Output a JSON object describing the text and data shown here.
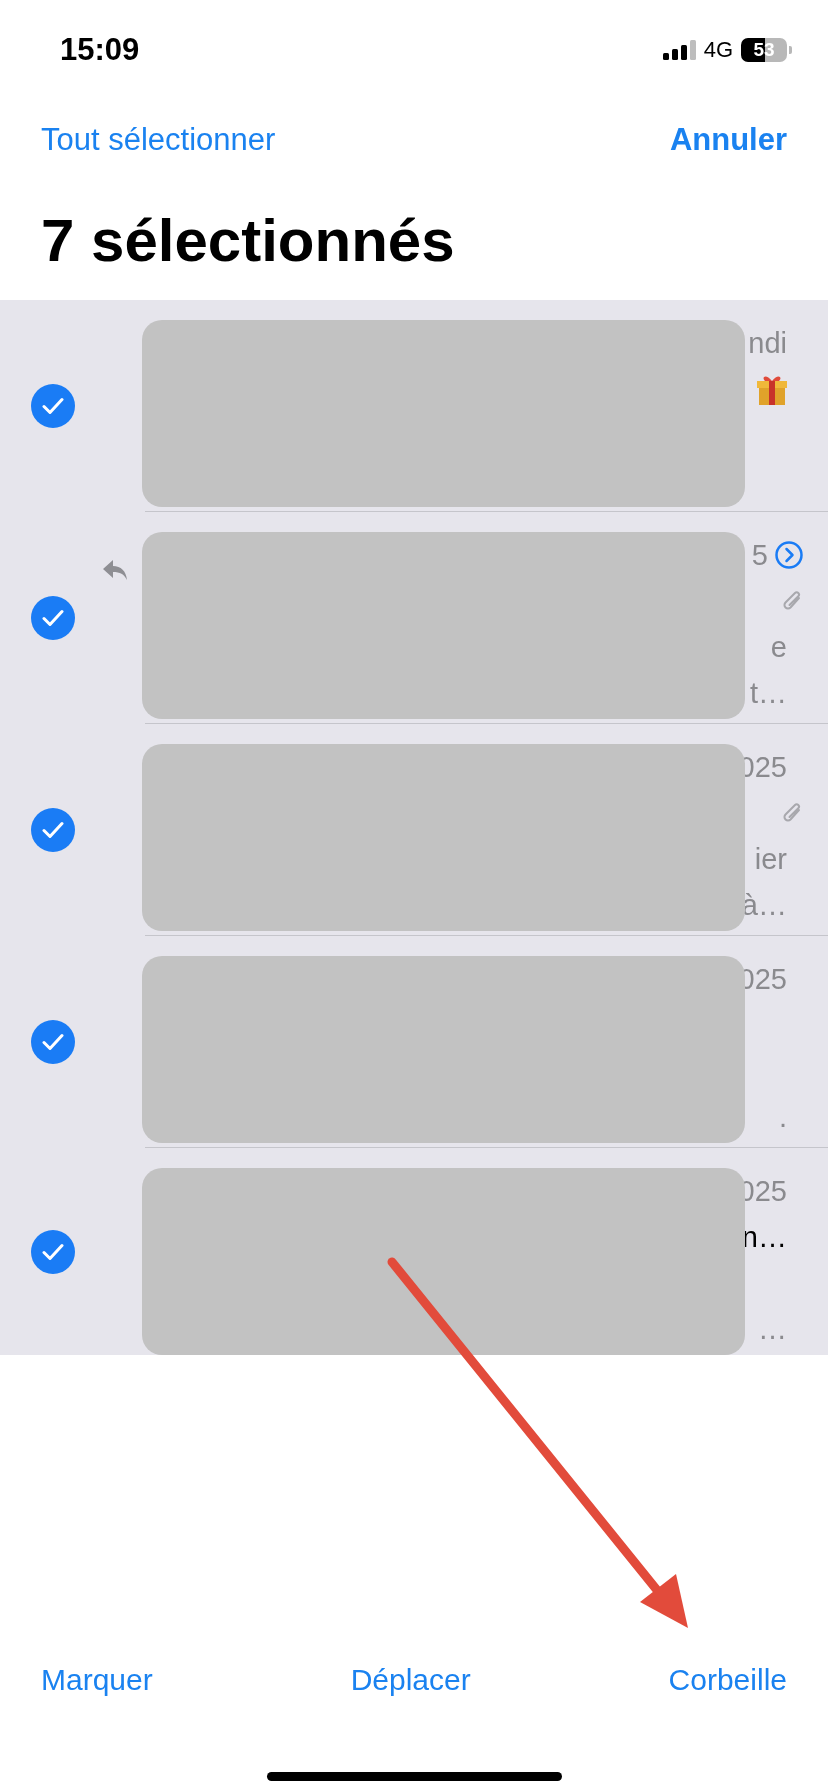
{
  "status_bar": {
    "time": "15:09",
    "network": "4G",
    "battery": "53"
  },
  "nav": {
    "select_all": "Tout sélectionner",
    "cancel": "Annuler"
  },
  "title": "7 sélectionnés",
  "messages": [
    {
      "selected": true,
      "replied": false,
      "thread": false,
      "attachment": false,
      "gift": true,
      "date": "ndi"
    },
    {
      "selected": true,
      "replied": true,
      "thread": true,
      "attachment": true,
      "gift": false,
      "date": "5",
      "preview_line_1": "e",
      "preview_line_2": "t…"
    },
    {
      "selected": true,
      "replied": false,
      "thread": false,
      "attachment": true,
      "gift": false,
      "date": "025",
      "preview_line_1": "ier",
      "preview_line_2": "à…"
    },
    {
      "selected": true,
      "replied": false,
      "thread": false,
      "attachment": false,
      "gift": false,
      "date": "025",
      "preview_line_2": "."
    },
    {
      "selected": true,
      "replied": false,
      "thread": false,
      "attachment": false,
      "gift": false,
      "date": "025",
      "subject": "n…",
      "preview_line_2": "…"
    }
  ],
  "toolbar": [
    "Marquer",
    "Déplacer",
    "Corbeille"
  ]
}
